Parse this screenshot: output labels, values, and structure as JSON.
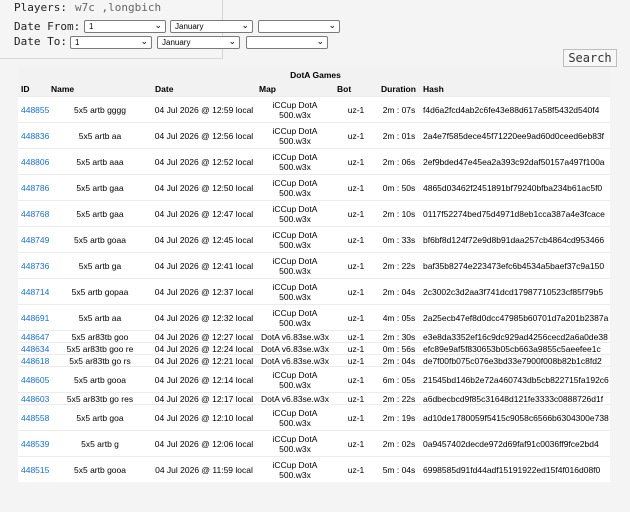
{
  "filters": {
    "players_label": "Players:",
    "players_value": "w7c ,longbich",
    "date_from_label": "Date From:",
    "date_to_label": "Date To:",
    "from_day": "1",
    "from_month": "January",
    "from_year": "",
    "to_day": "1",
    "to_month": "January",
    "to_year": ""
  },
  "search_label": "Search",
  "table": {
    "title": "DotA Games",
    "columns": [
      "ID",
      "Name",
      "Date",
      "Map",
      "Bot",
      "Duration",
      "Hash"
    ],
    "rows": [
      {
        "id": "448855",
        "name": "5x5 artb gggg",
        "date": "04 Jul 2026 @ 12:59 local",
        "map1": "iCCup DotA",
        "map2": "500.w3x",
        "bot": "uz-1",
        "duration": "2m : 07s",
        "hash": "f4d6a2fcd4ab2c6fe43e88d617a58f5432d540f4"
      },
      {
        "id": "448836",
        "name": "5x5 artb aa",
        "date": "04 Jul 2026 @ 12:56 local",
        "map1": "iCCup DotA",
        "map2": "500.w3x",
        "bot": "uz-1",
        "duration": "2m : 01s",
        "hash": "2a4e7f585dece45f71220ee9ad60d0ceed6eb83f"
      },
      {
        "id": "448806",
        "name": "5x5 artb aaa",
        "date": "04 Jul 2026 @ 12:52 local",
        "map1": "iCCup DotA",
        "map2": "500.w3x",
        "bot": "uz-1",
        "duration": "2m : 06s",
        "hash": "2ef9bded47e45ea2a393c92daf50157a497f100a"
      },
      {
        "id": "448786",
        "name": "5x5 artb gaa",
        "date": "04 Jul 2026 @ 12:50 local",
        "map1": "iCCup DotA",
        "map2": "500.w3x",
        "bot": "uz-1",
        "duration": "0m : 50s",
        "hash": "4865d03462f2451891bf79240bfba234b61ac5f0"
      },
      {
        "id": "448768",
        "name": "5x5 artb gaa",
        "date": "04 Jul 2026 @ 12:47 local",
        "map1": "iCCup DotA",
        "map2": "500.w3x",
        "bot": "uz-1",
        "duration": "2m : 10s",
        "hash": "0117f52274bed75d4971d8eb1cca387a4e3fcace"
      },
      {
        "id": "448749",
        "name": "5x5 artb goaa",
        "date": "04 Jul 2026 @ 12:45 local",
        "map1": "iCCup DotA",
        "map2": "500.w3x",
        "bot": "uz-1",
        "duration": "0m : 33s",
        "hash": "bf6bf8d124f72e9d8b91daa257cb4864cd953466"
      },
      {
        "id": "448736",
        "name": "5x5 artb ga",
        "date": "04 Jul 2026 @ 12:41 local",
        "map1": "iCCup DotA",
        "map2": "500.w3x",
        "bot": "uz-1",
        "duration": "2m : 22s",
        "hash": "baf35b8274e223473efc6b4534a5baef37c9a150"
      },
      {
        "id": "448714",
        "name": "5x5 artb gopaa",
        "date": "04 Jul 2026 @ 12:37 local",
        "map1": "iCCup DotA",
        "map2": "500.w3x",
        "bot": "uz-1",
        "duration": "2m : 04s",
        "hash": "2c3002c3d2aa3f741dcd17987710523cf85f79b5"
      },
      {
        "id": "448691",
        "name": "5x5 artb aa",
        "date": "04 Jul 2026 @ 12:32 local",
        "map1": "iCCup DotA",
        "map2": "500.w3x",
        "bot": "uz-1",
        "duration": "4m : 05s",
        "hash": "2a25ecb47ef8d0dcc47985b60701d7a201b2387a"
      },
      {
        "id": "448647",
        "name": "5x5 ar83tb goo",
        "date": "04 Jul 2026 @ 12:27 local",
        "map1": "DotA v6.83se.w3x",
        "map2": "",
        "bot": "uz-1",
        "duration": "2m : 30s",
        "hash": "e3e8da3352ef16c9dc929ad4256cecd2a6a0de38"
      },
      {
        "id": "448634",
        "name": "5x5 ar83tb goo re",
        "date": "04 Jul 2026 @ 12:24 local",
        "map1": "DotA v6.83se.w3x",
        "map2": "",
        "bot": "uz-1",
        "duration": "0m : 56s",
        "hash": "efc89e9af5f830653b05cb663a9855c5aeefee1c"
      },
      {
        "id": "448618",
        "name": "5x5 ar83tb go rs",
        "date": "04 Jul 2026 @ 12:21 local",
        "map1": "DotA v6.83se.w3x",
        "map2": "",
        "bot": "uz-1",
        "duration": "2m : 04s",
        "hash": "de7f00fb075c076e3bd33e7900f008b82b1c8fd2"
      },
      {
        "id": "448605",
        "name": "5x5 artb gooa",
        "date": "04 Jul 2026 @ 12:14 local",
        "map1": "iCCup DotA",
        "map2": "500.w3x",
        "bot": "uz-1",
        "duration": "6m : 05s",
        "hash": "21545bd146b2e72a460743db5cb822715fa192c6"
      },
      {
        "id": "448603",
        "name": "5x5 ar83tb go res",
        "date": "04 Jul 2026 @ 12:17 local",
        "map1": "DotA v6.83se.w3x",
        "map2": "",
        "bot": "uz-1",
        "duration": "2m : 22s",
        "hash": "a6dbecbcd9f85c31648d121fe3333c0888726d1f"
      },
      {
        "id": "448558",
        "name": "5x5 artb goa",
        "date": "04 Jul 2026 @ 12:10 local",
        "map1": "iCCup DotA",
        "map2": "500.w3x",
        "bot": "uz-1",
        "duration": "2m : 19s",
        "hash": "ad10de1780059f5415c9058c6566b6304300e738"
      },
      {
        "id": "448539",
        "name": "5x5 artb g",
        "date": "04 Jul 2026 @ 12:06 local",
        "map1": "iCCup DotA",
        "map2": "500.w3x",
        "bot": "uz-1",
        "duration": "2m : 02s",
        "hash": "0a9457402decde972d69faf91c0036ff9fce2bd4"
      },
      {
        "id": "448515",
        "name": "5x5 artb gooa",
        "date": "04 Jul 2026 @ 11:59 local",
        "map1": "iCCup DotA",
        "map2": "500.w3x",
        "bot": "uz-1",
        "duration": "5m : 04s",
        "hash": "6998585d91fd44adf15191922ed15f4f016d08f0"
      }
    ]
  }
}
